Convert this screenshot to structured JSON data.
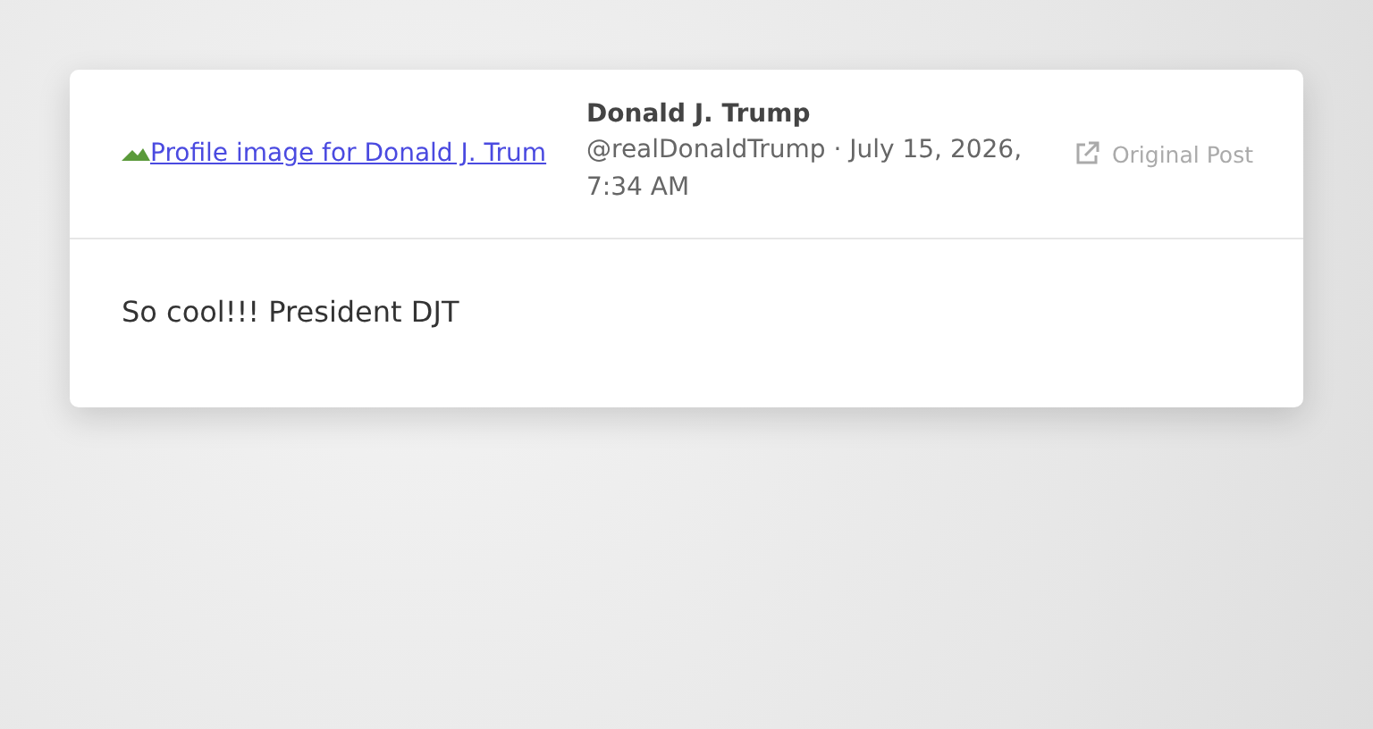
{
  "post": {
    "avatar_alt": "Profile image for Donald J. Trum",
    "author": "Donald J. Trump",
    "handle_date": "@realDonaldTrump · July 15, 2026, 7:34 AM",
    "original_link": "Original Post",
    "body": "So cool!!! President DJT"
  }
}
